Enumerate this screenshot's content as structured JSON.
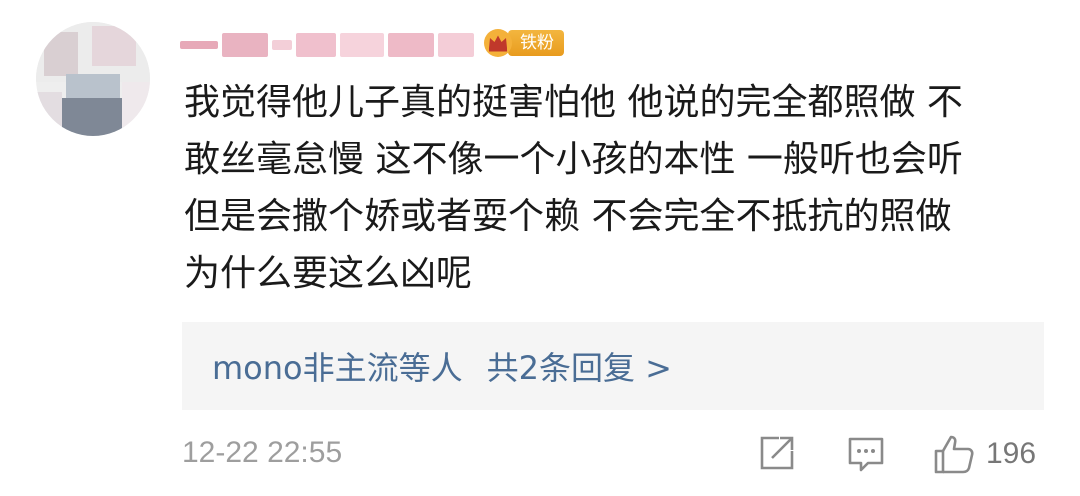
{
  "comment": {
    "badge": "铁粉",
    "lines": [
      "我觉得他儿子真的挺害怕他 他说的完全都照做 不",
      "敢丝毫怠慢 这不像一个小孩的本性 一般听也会听",
      "但是会撒个娇或者耍个赖 不会完全不抵抗的照做",
      "为什么要这么凶呢"
    ],
    "replies": {
      "users": "mono非主流等人",
      "count_text": "共2条回复 >"
    },
    "timestamp": "12-22 22:55",
    "likes": "196"
  },
  "icons": {
    "share": "share-icon",
    "reply": "comment-icon",
    "like": "thumbs-up-icon"
  },
  "colors": {
    "link": "#4a6d95",
    "badge": "#eea52b",
    "muted": "#9e9e9e",
    "reply_bg": "#f5f5f5"
  }
}
